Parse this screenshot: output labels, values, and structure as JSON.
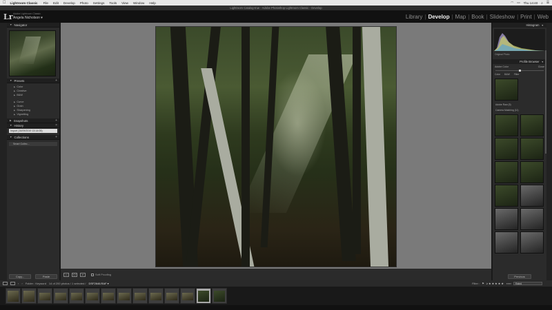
{
  "menubar": {
    "apple": "",
    "app": "Lightroom Classic",
    "items": [
      "File",
      "Edit",
      "Develop",
      "Photo",
      "Settings",
      "Tools",
      "View",
      "Window",
      "Help"
    ],
    "clock": "Thu 14:40"
  },
  "window": {
    "title": "Lightroom Catalog-true - Adobe Photoshop Lightroom Classic - Develop"
  },
  "identity": {
    "logo": "Lr",
    "catalog": "Adobe Lightroom Classic",
    "user": "Angela Nicholson ▾"
  },
  "modules": [
    "Library",
    "Develop",
    "Map",
    "Book",
    "Slideshow",
    "Print",
    "Web"
  ],
  "left_panel": {
    "navigator": "Navigator",
    "presets": {
      "title": "Presets",
      "items": [
        "Color",
        "Creative",
        "B&W"
      ],
      "items2": [
        "Curve",
        "Grain",
        "Sharpening",
        "Vignetting"
      ]
    },
    "snapshots": "Snapshots",
    "history": {
      "title": "History",
      "item": "Import (16/09/2019 13:14:05)"
    },
    "collections": {
      "title": "Collections",
      "item": "Smart Collec..."
    },
    "copy": "Copy...",
    "paste": "Paste"
  },
  "toolbar": {
    "soft_proof": "Soft Proofing"
  },
  "right_panel": {
    "histogram": "Histogram",
    "original_photo": "Original Photo",
    "profile_browser": "Profile Browser",
    "adobe_color": "Adobe Color",
    "close": "Close",
    "tabs": [
      "Color",
      "B&W",
      "Filter"
    ],
    "group_adobe": "Adobe Raw (5)",
    "group_creative": "Camera Matching (11)",
    "previous": "Previous"
  },
  "filmstrip_bar": {
    "source": "Folder : Keyword",
    "count": "14 of 200 photos / 1 selected /",
    "file": "DSF2646.RAF ▾",
    "filter": "Filter :",
    "filter_value": "Rated"
  },
  "colors": {
    "accent": "#f2f2f2",
    "panel": "#2b2b2b",
    "canvas": "#7a7a7a"
  }
}
